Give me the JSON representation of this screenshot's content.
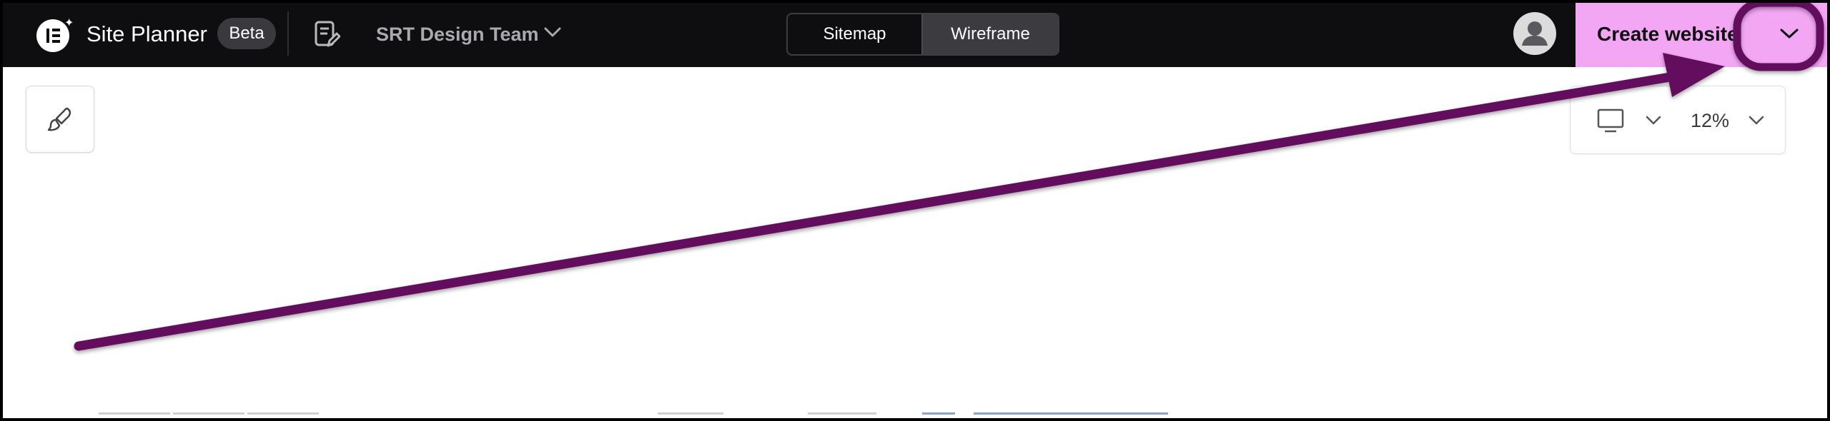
{
  "header": {
    "app_name": "Site Planner",
    "badge": "Beta",
    "team_selector": "SRT Design Team",
    "view_tabs": [
      {
        "label": "Sitemap",
        "active": false
      },
      {
        "label": "Wireframe",
        "active": true
      }
    ],
    "create_button": "Create website",
    "create_button_color": "#f2a6f4",
    "background": "#0e0e10"
  },
  "canvas_toolbar": {
    "device": "desktop-monitor-icon",
    "zoom": "12%"
  },
  "annotation": {
    "arrow_color": "#640a5e",
    "highlight": "create-website-dropdown"
  },
  "icons": {
    "logo": "elementor-logo",
    "document": "document-edit-icon",
    "brush": "paint-brush-icon",
    "avatar": "user-avatar-icon",
    "device": "monitor-icon"
  }
}
